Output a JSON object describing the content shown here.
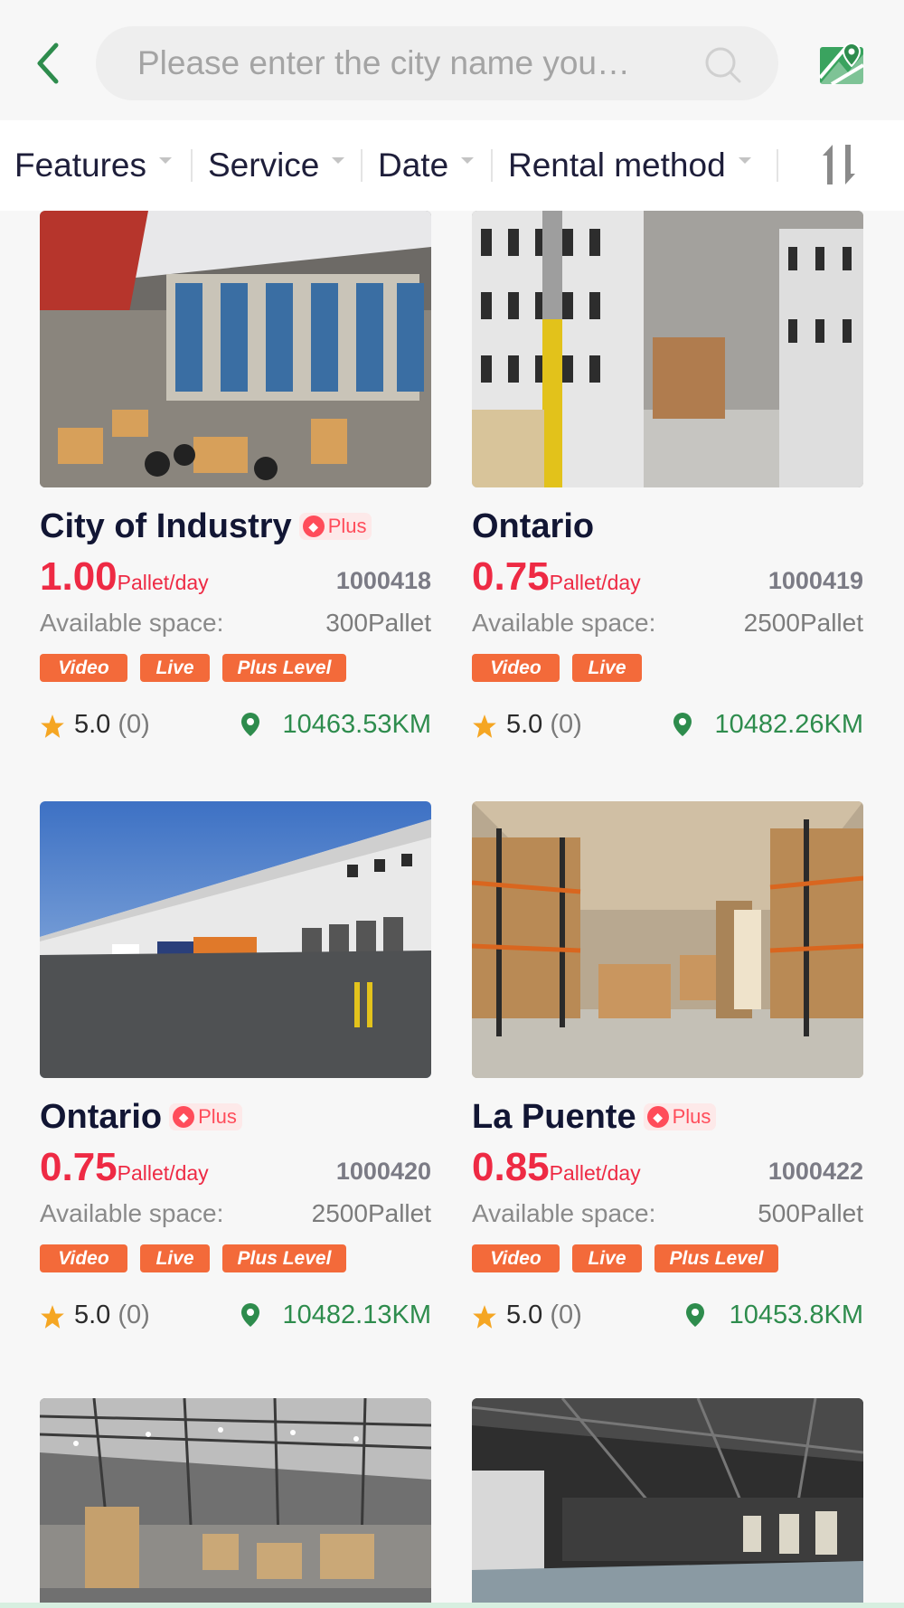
{
  "search": {
    "placeholder": "Please enter the city name you…"
  },
  "filters": [
    {
      "label": "Features"
    },
    {
      "label": "Service"
    },
    {
      "label": "Date"
    },
    {
      "label": "Rental method"
    }
  ],
  "colors": {
    "accent_green": "#2e8c4d",
    "price_red": "#ee2a44",
    "tag_orange": "#f36a3a"
  },
  "icons": {
    "back": "chevron-left-icon",
    "search": "search-icon",
    "map": "map-icon",
    "sort": "sort-icon",
    "star": "star-icon",
    "location": "location-pin-icon"
  },
  "common": {
    "unit": "Pallet/day",
    "space_label": "Available space:",
    "tag_video": "Video",
    "tag_live": "Live",
    "tag_plus": "Plus Level",
    "plus_badge": "Plus"
  },
  "cards": [
    {
      "name": "City of Industry",
      "plus": true,
      "price": "1.00",
      "code": "1000418",
      "space": "300Pallet",
      "tags": [
        "Video",
        "Live",
        "Plus Level"
      ],
      "rating": "5.0",
      "reviews": "(0)",
      "distance": "10463.53KM"
    },
    {
      "name": "Ontario",
      "plus": false,
      "price": "0.75",
      "code": "1000419",
      "space": "2500Pallet",
      "tags": [
        "Video",
        "Live"
      ],
      "rating": "5.0",
      "reviews": "(0)",
      "distance": "10482.26KM"
    },
    {
      "name": "Ontario",
      "plus": true,
      "price": "0.75",
      "code": "1000420",
      "space": "2500Pallet",
      "tags": [
        "Video",
        "Live",
        "Plus Level"
      ],
      "rating": "5.0",
      "reviews": "(0)",
      "distance": "10482.13KM"
    },
    {
      "name": "La Puente",
      "plus": true,
      "price": "0.85",
      "code": "1000422",
      "space": "500Pallet",
      "tags": [
        "Video",
        "Live",
        "Plus Level"
      ],
      "rating": "5.0",
      "reviews": "(0)",
      "distance": "10453.8KM"
    }
  ]
}
